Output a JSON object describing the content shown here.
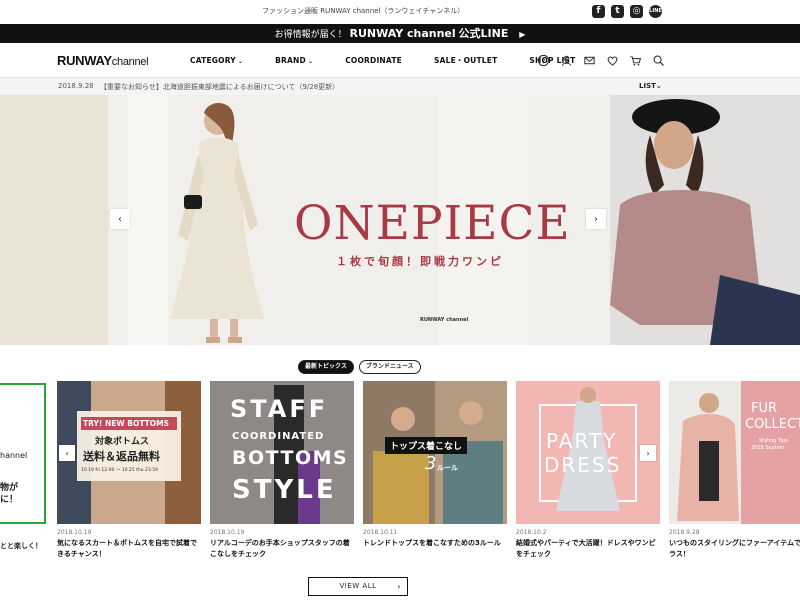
{
  "top_strip": {
    "site_tag": "ファッション通販 RUNWAY channel（ランウェイチャンネル）",
    "sns": [
      {
        "icon": "facebook-icon",
        "glyph": "f"
      },
      {
        "icon": "twitter-icon",
        "glyph": "t"
      },
      {
        "icon": "instagram-icon",
        "glyph": "◎"
      },
      {
        "icon": "line-icon",
        "glyph": "LINE"
      }
    ]
  },
  "line_bar": {
    "lead": "お得情報が届く！",
    "brand": "RUNWAY channel",
    "suffix": "公式LINE",
    "arrow": "▶"
  },
  "header": {
    "logo_main": "RUNWAY",
    "logo_sub": "channel",
    "nav": [
      {
        "label": "CATEGORY",
        "caret": "⌄"
      },
      {
        "label": "BRAND",
        "caret": "⌄"
      },
      {
        "label": "COORDINATE",
        "caret": ""
      },
      {
        "label": "SALE・OUTLET",
        "caret": ""
      },
      {
        "label": "SHOP LIST",
        "caret": ""
      }
    ],
    "icons": [
      "help-icon",
      "user-icon",
      "mail-icon",
      "heart-icon",
      "cart-icon",
      "search-icon"
    ]
  },
  "news": {
    "date": "2018.9.28",
    "text": "【重要なお知らせ】北海道胆振東部地震によるお届けについて（9/28更新）",
    "list_label": "LIST⌄"
  },
  "hero": {
    "title": "ONEPIECE",
    "subtitle": "１枚で旬顔！即戦力ワンピ",
    "brand_mark": "RUNWAY channel",
    "prev": "‹",
    "next": "›",
    "colors": {
      "accent": "#a83a45"
    }
  },
  "tabs": [
    {
      "label": "最新トピックス",
      "active": true
    },
    {
      "label": "ブランドニュース",
      "active": false
    }
  ],
  "left_card": {
    "line1": "hannel",
    "line2a": "物が",
    "line2b": "に！",
    "caption": "とと楽しく！"
  },
  "cards": [
    {
      "date": "2018.10.19",
      "title1": "気になるスカート＆ボトムスを自宅で試着で",
      "title2": "きるチャンス！",
      "overlay": [
        "TRY! NEW BOTTOMS",
        "対象ボトムス",
        "送料＆返品無料",
        "10.19 fri 12:00 ～ 10.25 thu 23:59"
      ],
      "bg": "#c6a88c"
    },
    {
      "date": "2018.10.19",
      "title1": "リアルコーデのお手本ショップスタッフの着",
      "title2": "こなしをチェック",
      "overlay": [
        "STAFF",
        "COORDINATED",
        "BOTTOMS",
        "STYLE"
      ],
      "bg": "#8f8a86"
    },
    {
      "date": "2018.10.11",
      "title1": "トレンドトップスを着こなすための3ルール",
      "title2": "",
      "overlay": [
        "トップス着こなし",
        "3",
        "ルール"
      ],
      "bg": "#a7957e"
    },
    {
      "date": "2018.10.2",
      "title1": "結婚式やパーティで大活躍！ドレスやワンピ",
      "title2": "をチェック",
      "overlay": [
        "PARTY",
        "DRESS"
      ],
      "bg": "#f3b7b3"
    },
    {
      "date": "2018.9.28",
      "title1": "いつものスタイリングにファーアイテムで",
      "title2": "ラス！",
      "overlay": [
        "FUR",
        "COLLECTIO",
        "Styling Tips",
        "2018 Septem"
      ],
      "bg": "#e9a8ab"
    }
  ],
  "carousel": {
    "prev": "‹",
    "next": "›"
  },
  "view_all": {
    "label": "VIEW ALL",
    "chev": "›"
  }
}
